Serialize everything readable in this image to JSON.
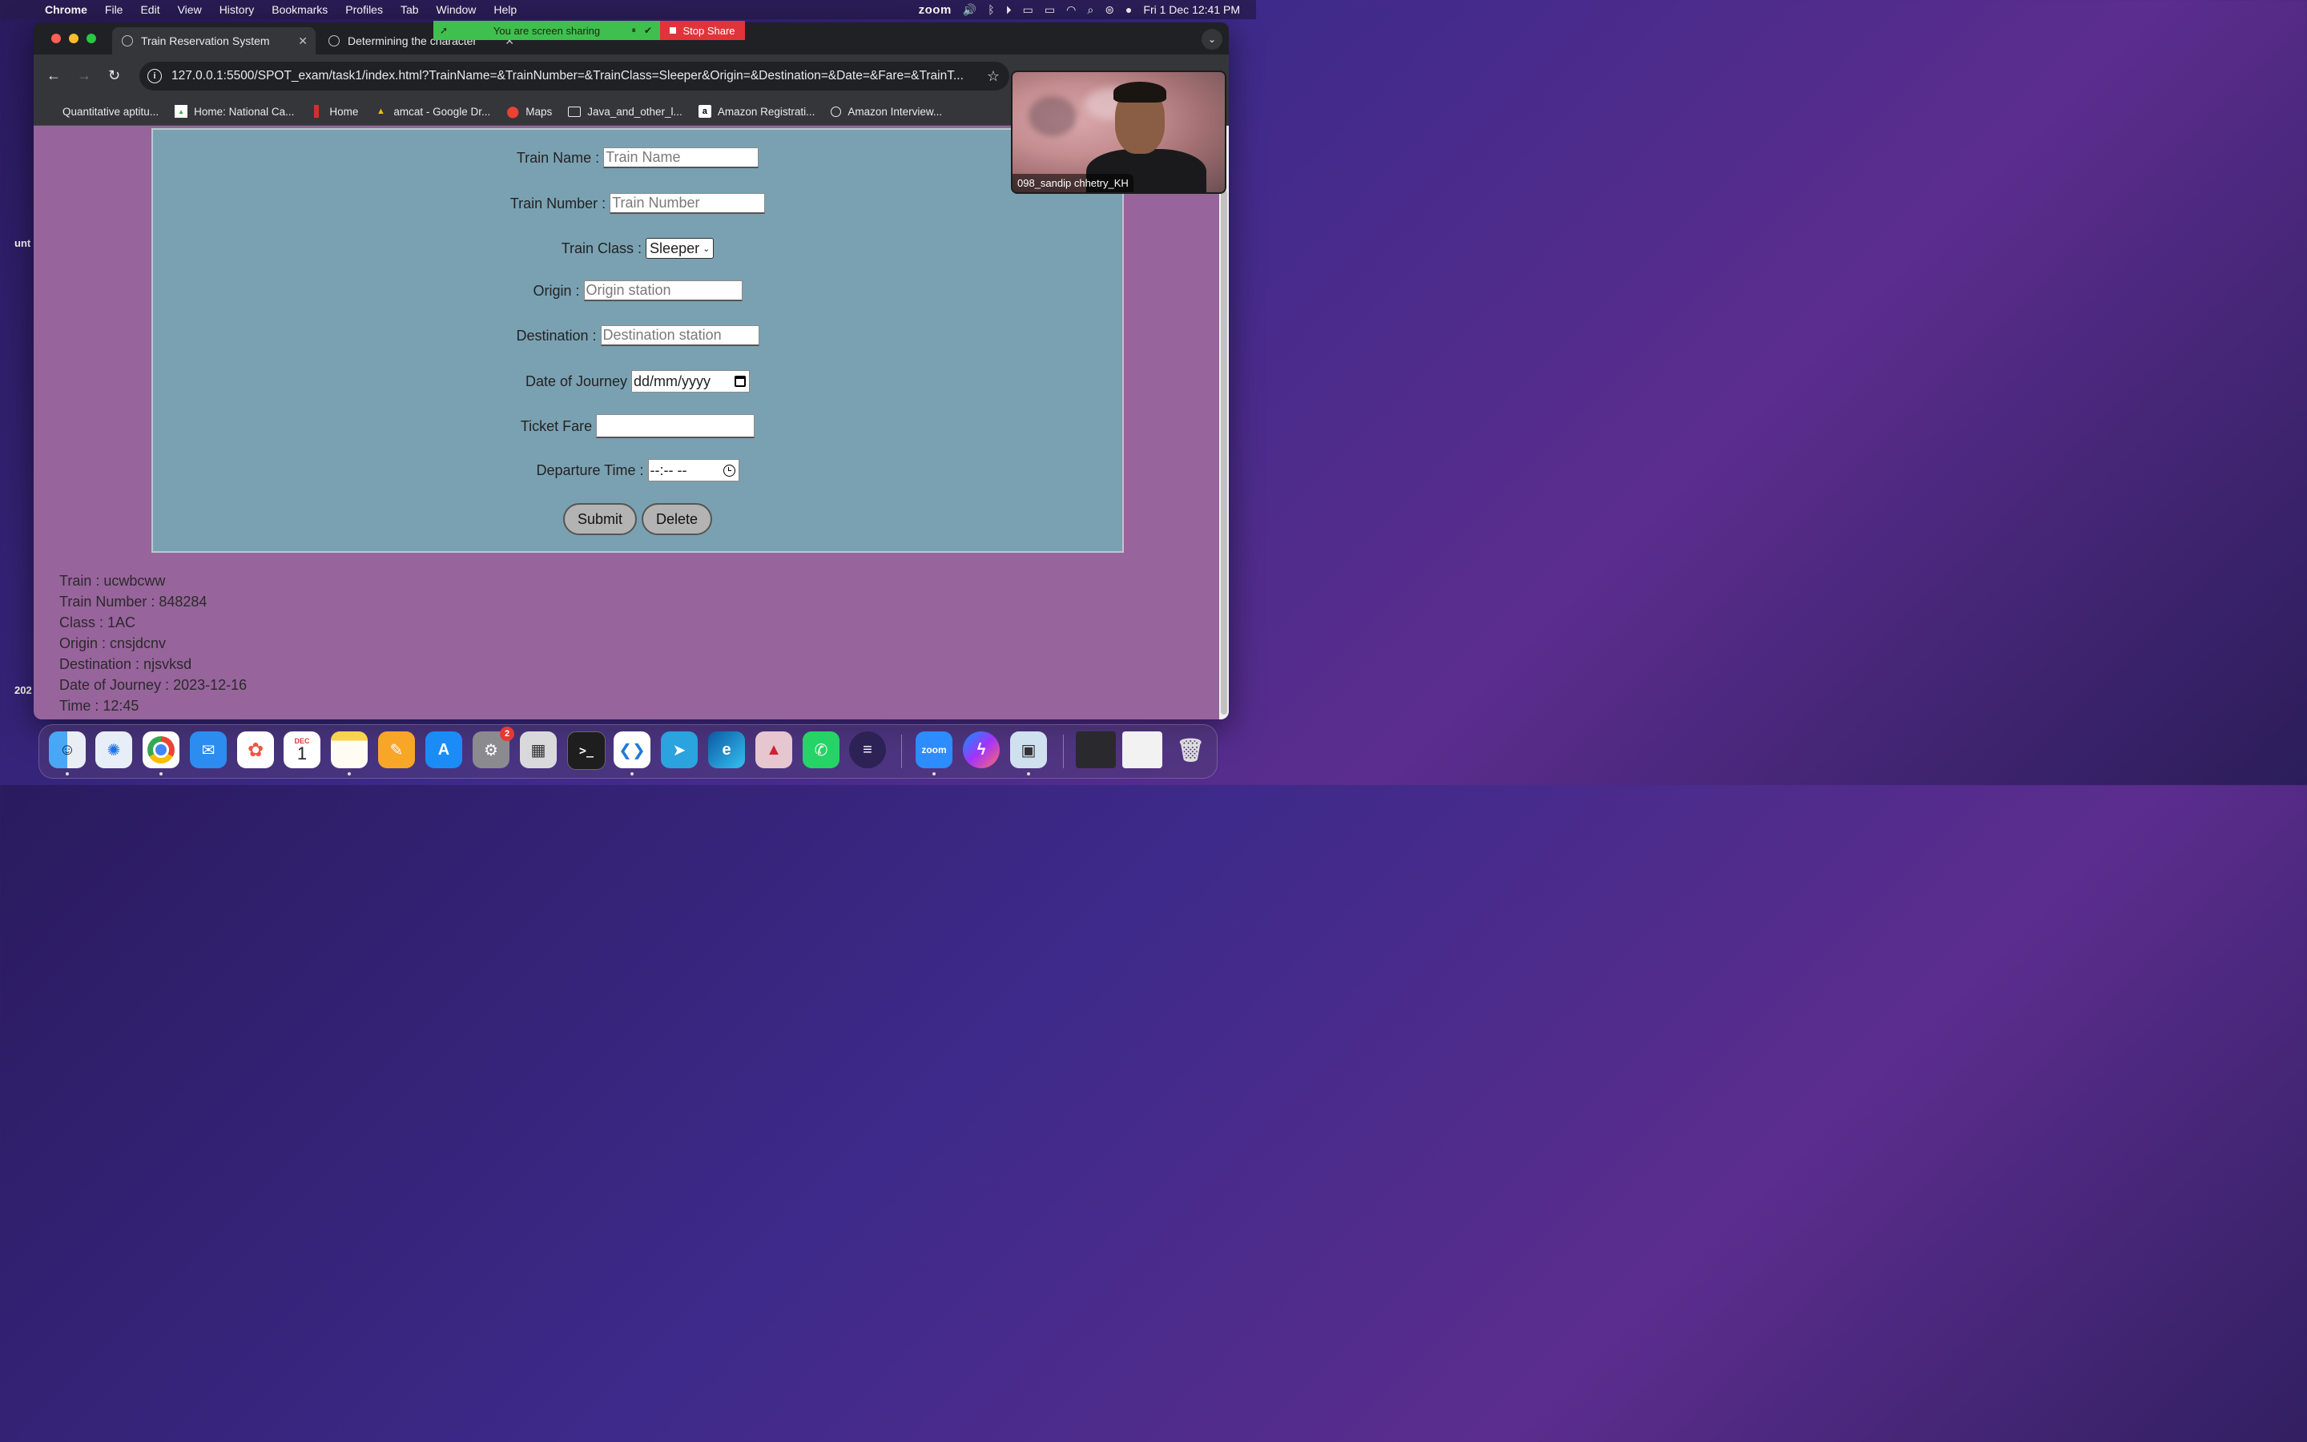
{
  "menubar": {
    "app": "Chrome",
    "items": [
      "File",
      "Edit",
      "View",
      "History",
      "Bookmarks",
      "Profiles",
      "Tab",
      "Window",
      "Help"
    ],
    "zoom_label": "zoom",
    "datetime": "Fri 1 Dec  12:41 PM"
  },
  "share_bar": {
    "status": "You are screen sharing",
    "stop_label": "Stop Share"
  },
  "desktop": {
    "label_top": "unt",
    "label_bottom": "202"
  },
  "browser": {
    "tabs": [
      {
        "title": "Train Reservation System",
        "active": true
      },
      {
        "title": "Determining the character",
        "active": false
      }
    ],
    "url": "127.0.0.1:5500/SPOT_exam/task1/index.html?TrainName=&TrainNumber=&TrainClass=Sleeper&Origin=&Destination=&Date=&Fare=&TrainT...",
    "bookmarks": [
      "Quantitative aptitu...",
      "Home: National Ca...",
      "Home",
      "amcat - Google Dr...",
      "Maps",
      "Java_and_other_l...",
      "Amazon Registrati...",
      "Amazon Interview..."
    ]
  },
  "form": {
    "train_name": {
      "label": "Train Name :",
      "placeholder": "Train Name"
    },
    "train_number": {
      "label": "Train Number :",
      "placeholder": "Train Number"
    },
    "train_class": {
      "label": "Train Class :",
      "value": "Sleeper"
    },
    "origin": {
      "label": "Origin :",
      "placeholder": "Origin station"
    },
    "destination": {
      "label": "Destination :",
      "placeholder": "Destination station"
    },
    "date": {
      "label": "Date of Journey",
      "value": "dd/mm/yyyy"
    },
    "fare": {
      "label": "Ticket Fare",
      "value": ""
    },
    "departure": {
      "label": "Departure Time :",
      "value": "--:-- --"
    },
    "submit_label": "Submit",
    "delete_label": "Delete"
  },
  "record": {
    "train": "Train : ucwbcww",
    "number": "Train Number : 848284",
    "class": "Class : 1AC",
    "origin": "Origin : cnsjdcnv",
    "destination": "Destination : njsvksd",
    "date": "Date of Journey : 2023-12-16",
    "time": "Time : 12:45"
  },
  "video": {
    "participant": "098_sandip chhetry_KH"
  },
  "dock": {
    "calendar_month": "DEC",
    "calendar_day": "1",
    "settings_badge": "2",
    "zoom_label": "zoom"
  },
  "colors": {
    "page_background": "#98649c",
    "form_background": "#7aa1b2",
    "share_green": "#3fbf4e",
    "stop_red": "#e0343a"
  }
}
